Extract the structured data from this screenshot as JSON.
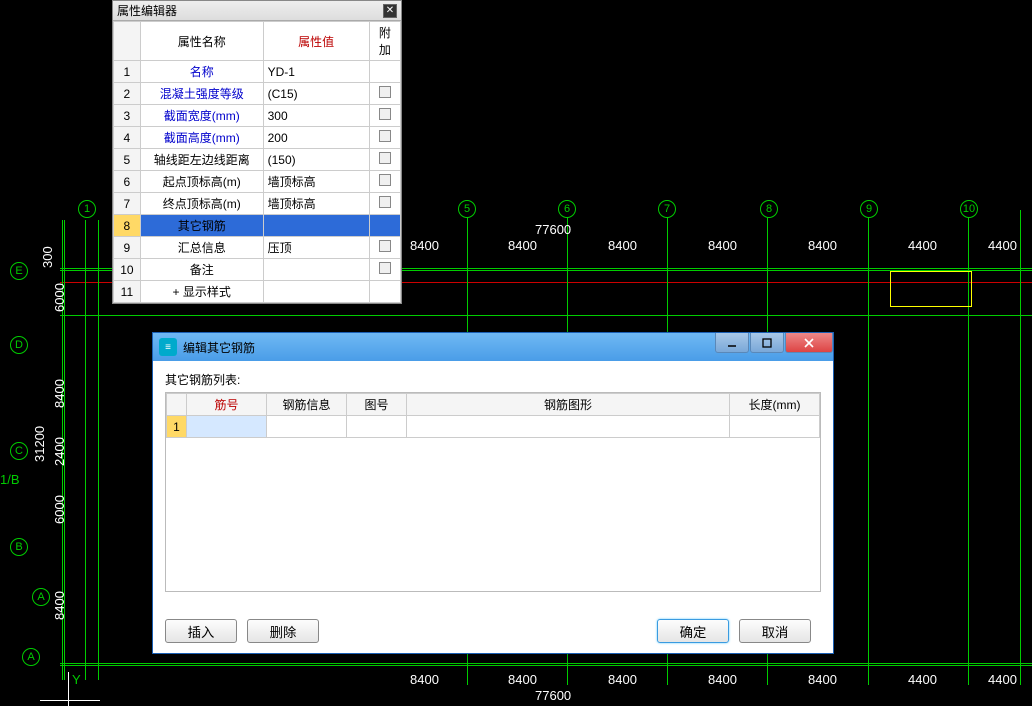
{
  "propPanel": {
    "title": "属性编辑器",
    "headers": {
      "name": "属性名称",
      "value": "属性值",
      "extra": "附加"
    },
    "rows": [
      {
        "n": "1",
        "name": "名称",
        "value": "YD-1",
        "color": "blue",
        "extra": ""
      },
      {
        "n": "2",
        "name": "混凝土强度等级",
        "value": "(C15)",
        "color": "blue",
        "extra": "chk"
      },
      {
        "n": "3",
        "name": "截面宽度(mm)",
        "value": "300",
        "color": "blue",
        "extra": "chk"
      },
      {
        "n": "4",
        "name": "截面高度(mm)",
        "value": "200",
        "color": "blue",
        "extra": "chk"
      },
      {
        "n": "5",
        "name": "轴线距左边线距离",
        "value": "(150)",
        "color": "black",
        "extra": "chk"
      },
      {
        "n": "6",
        "name": "起点顶标高(m)",
        "value": "墙顶标高",
        "color": "black",
        "extra": "chk"
      },
      {
        "n": "7",
        "name": "终点顶标高(m)",
        "value": "墙顶标高",
        "color": "black",
        "extra": "chk"
      },
      {
        "n": "8",
        "name": "其它钢筋",
        "value": "",
        "color": "black",
        "extra": "",
        "selected": true
      },
      {
        "n": "9",
        "name": "汇总信息",
        "value": "压顶",
        "color": "black",
        "extra": "chk"
      },
      {
        "n": "10",
        "name": "备注",
        "value": "",
        "color": "black",
        "extra": "chk"
      },
      {
        "n": "11",
        "name": "显示样式",
        "value": "",
        "color": "black",
        "extra": "expand"
      }
    ]
  },
  "dialog": {
    "title": "编辑其它钢筋",
    "listLabel": "其它钢筋列表:",
    "headers": {
      "no": "筋号",
      "info": "钢筋信息",
      "code": "图号",
      "shape": "钢筋图形",
      "len": "长度(mm)"
    },
    "firstRowNum": "1",
    "buttons": {
      "insert": "插入",
      "delete": "删除",
      "ok": "确定",
      "cancel": "取消"
    }
  },
  "cad": {
    "topDims": [
      "8400",
      "8400",
      "8400",
      "8400",
      "8400",
      "4400"
    ],
    "bottomDims": [
      "8400",
      "8400",
      "8400",
      "8400",
      "8400",
      "4400"
    ],
    "totalDim": "77600",
    "leftDims": [
      "300",
      "6000",
      "8400",
      "2400",
      "31200",
      "6000",
      "8400"
    ],
    "topBubbles": [
      "1",
      "5",
      "6",
      "7",
      "8",
      "9",
      "10"
    ],
    "leftBubbles": [
      "E",
      "D",
      "C",
      "1/B",
      "B",
      "A",
      "A"
    ]
  }
}
